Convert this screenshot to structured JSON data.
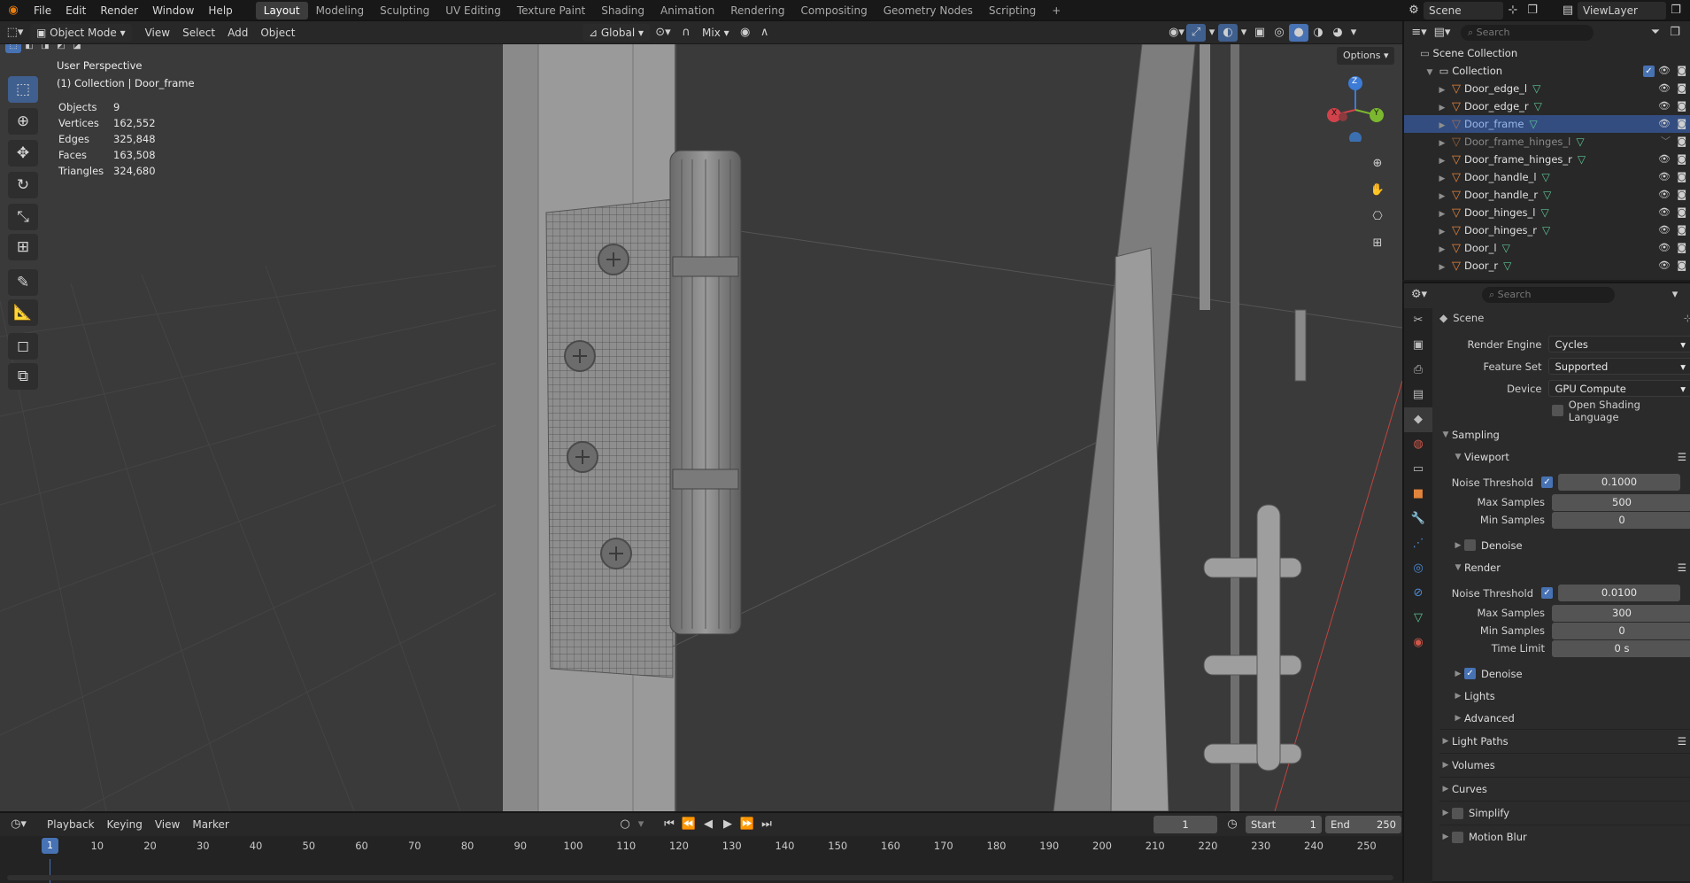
{
  "menu": {
    "items": [
      "File",
      "Edit",
      "Render",
      "Window",
      "Help"
    ],
    "workspaces": [
      "Layout",
      "Modeling",
      "Sculpting",
      "UV Editing",
      "Texture Paint",
      "Shading",
      "Animation",
      "Rendering",
      "Compositing",
      "Geometry Nodes",
      "Scripting"
    ],
    "active_workspace": "Layout",
    "add_tab": "+",
    "scene": "Scene",
    "view_layer": "ViewLayer"
  },
  "viewport_header": {
    "mode": "Object Mode",
    "menus": [
      "View",
      "Select",
      "Add",
      "Object"
    ],
    "orientation": "Global",
    "snap_label": "Mix",
    "options": "Options"
  },
  "overlay": {
    "perspective": "User Perspective",
    "context": "(1) Collection | Door_frame",
    "stats": [
      {
        "k": "Objects",
        "v": "9"
      },
      {
        "k": "Vertices",
        "v": "162,552"
      },
      {
        "k": "Edges",
        "v": "325,848"
      },
      {
        "k": "Faces",
        "v": "163,508"
      },
      {
        "k": "Triangles",
        "v": "324,680"
      }
    ],
    "gizmo": {
      "x": "X",
      "y": "Y",
      "z": "Z"
    }
  },
  "outliner": {
    "search_placeholder": "Search",
    "root": "Scene Collection",
    "collection": "Collection",
    "items": [
      {
        "name": "Door_edge_l",
        "state": "normal"
      },
      {
        "name": "Door_edge_r",
        "state": "normal"
      },
      {
        "name": "Door_frame",
        "state": "selected"
      },
      {
        "name": "Door_frame_hinges_l",
        "state": "hidden"
      },
      {
        "name": "Door_frame_hinges_r",
        "state": "normal"
      },
      {
        "name": "Door_handle_l",
        "state": "normal"
      },
      {
        "name": "Door_handle_r",
        "state": "normal"
      },
      {
        "name": "Door_hinges_l",
        "state": "normal"
      },
      {
        "name": "Door_hinges_r",
        "state": "normal"
      },
      {
        "name": "Door_l",
        "state": "normal"
      },
      {
        "name": "Door_r",
        "state": "normal"
      }
    ]
  },
  "properties": {
    "search_placeholder": "Search",
    "scene_label": "Scene",
    "render_engine_label": "Render Engine",
    "render_engine": "Cycles",
    "feature_set_label": "Feature Set",
    "feature_set": "Supported",
    "device_label": "Device",
    "device": "GPU Compute",
    "osl_label": "Open Shading Language",
    "sampling": "Sampling",
    "viewport": "Viewport",
    "noise_threshold_label": "Noise Threshold",
    "max_samples_label": "Max Samples",
    "min_samples_label": "Min Samples",
    "time_limit_label": "Time Limit",
    "viewport_noise_threshold": "0.1000",
    "viewport_max_samples": "500",
    "viewport_min_samples": "0",
    "denoise_label": "Denoise",
    "render": "Render",
    "render_noise_threshold": "0.0100",
    "render_max_samples": "300",
    "render_min_samples": "0",
    "render_time_limit": "0 s",
    "lights": "Lights",
    "advanced": "Advanced",
    "light_paths": "Light Paths",
    "volumes": "Volumes",
    "curves": "Curves",
    "simplify": "Simplify",
    "motion_blur": "Motion Blur"
  },
  "timeline": {
    "menus": [
      "Playback",
      "Keying",
      "View",
      "Marker"
    ],
    "current_frame": "1",
    "start_label": "Start",
    "start": "1",
    "end_label": "End",
    "end": "250",
    "ticks": [
      "10",
      "20",
      "30",
      "40",
      "50",
      "60",
      "70",
      "80",
      "90",
      "100",
      "110",
      "120",
      "130",
      "140",
      "150",
      "160",
      "170",
      "180",
      "190",
      "200",
      "210",
      "220",
      "230",
      "240",
      "250"
    ],
    "playhead": "1"
  },
  "colors": {
    "accent": "#4772b3",
    "selected_row": "#334d80",
    "object_icon": "#e3843c",
    "mesh_icon": "#5dc496"
  }
}
